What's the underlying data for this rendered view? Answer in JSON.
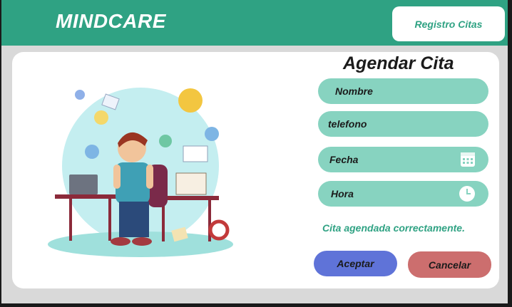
{
  "header": {
    "brand": "MINDCARE",
    "nav_button": "Registro Citas"
  },
  "form": {
    "title": "Agendar Cita",
    "fields": [
      {
        "label": "Nombre",
        "icon": null
      },
      {
        "label": "telefono",
        "icon": null
      },
      {
        "label": "Fecha",
        "icon": "calendar-icon"
      },
      {
        "label": "Hora",
        "icon": "clock-icon"
      }
    ],
    "status_message": "Cita agendada correctamente.",
    "accept_label": "Aceptar",
    "cancel_label": "Cancelar"
  },
  "colors": {
    "header": "#2fa283",
    "field": "#87d3c0",
    "accept": "#5f73d8",
    "cancel": "#cc6e6e",
    "background": "#d9d9d9"
  }
}
